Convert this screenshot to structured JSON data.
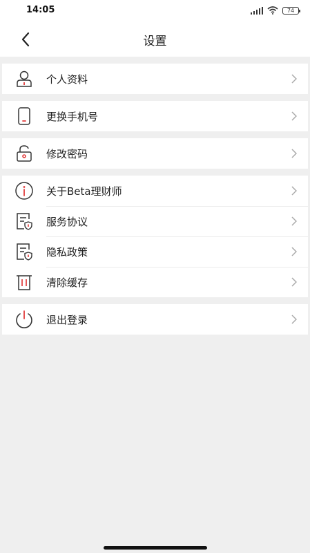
{
  "status_bar": {
    "time": "14:05",
    "battery": "74"
  },
  "nav": {
    "title": "设置"
  },
  "groups": [
    {
      "items": [
        {
          "label": "个人资料",
          "icon": "person-icon"
        }
      ]
    },
    {
      "items": [
        {
          "label": "更换手机号",
          "icon": "phone-icon"
        }
      ]
    },
    {
      "items": [
        {
          "label": "修改密码",
          "icon": "lock-icon"
        }
      ]
    },
    {
      "items": [
        {
          "label": "关于Beta理财师",
          "icon": "info-icon"
        },
        {
          "label": "服务协议",
          "icon": "document-shield-icon"
        },
        {
          "label": "隐私政策",
          "icon": "document-shield-icon"
        },
        {
          "label": "清除缓存",
          "icon": "trash-icon"
        }
      ]
    },
    {
      "items": [
        {
          "label": "退出登录",
          "icon": "power-icon"
        }
      ]
    }
  ],
  "colors": {
    "accent": "#e23b3b",
    "icon": "#333333",
    "background": "#efefef"
  }
}
